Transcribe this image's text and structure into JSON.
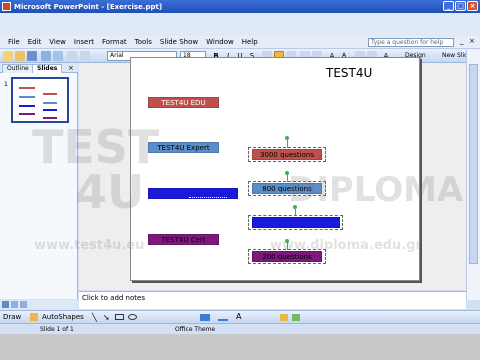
{
  "window": {
    "title": "Microsoft PowerPoint - [Exercise.ppt]"
  },
  "menu": {
    "items": [
      "File",
      "Edit",
      "View",
      "Insert",
      "Format",
      "Tools",
      "Slide Show",
      "Window",
      "Help"
    ],
    "help_placeholder": "Type a question for help"
  },
  "toolbar": {
    "font": "Arial",
    "font_size": "18",
    "design_label": "Design",
    "new_slide_label": "New Slide"
  },
  "pane": {
    "tabs": [
      "Outline",
      "Slides"
    ],
    "slide_number": "1"
  },
  "slide": {
    "title": "TEST4U",
    "shapes": {
      "s1": "TEST4U EDU",
      "s2": "TEST4U Expert",
      "s3": "",
      "s4": "TEST4U Cert",
      "s5": "3000 questions",
      "s6": "800 questions",
      "s7": "",
      "s8": "200 questions"
    }
  },
  "notes": {
    "placeholder": "Click to add notes"
  },
  "drawbar": {
    "draw_label": "Draw",
    "autoshapes_label": "AutoShapes"
  },
  "status": {
    "slide_info": "Slide 1 of 1",
    "theme": "Office Theme"
  },
  "watermark": {
    "line1": "TEST",
    "line2": "4U",
    "site1": "www.test4u.eu",
    "brand": "DIPLOMA",
    "site2": "www.diploma.edu.gr"
  },
  "colors": {
    "red_box": "#c0504d",
    "steel_box": "#5b8dc9",
    "blue_box": "#1a1adb",
    "purple_box": "#7b1a7b"
  }
}
